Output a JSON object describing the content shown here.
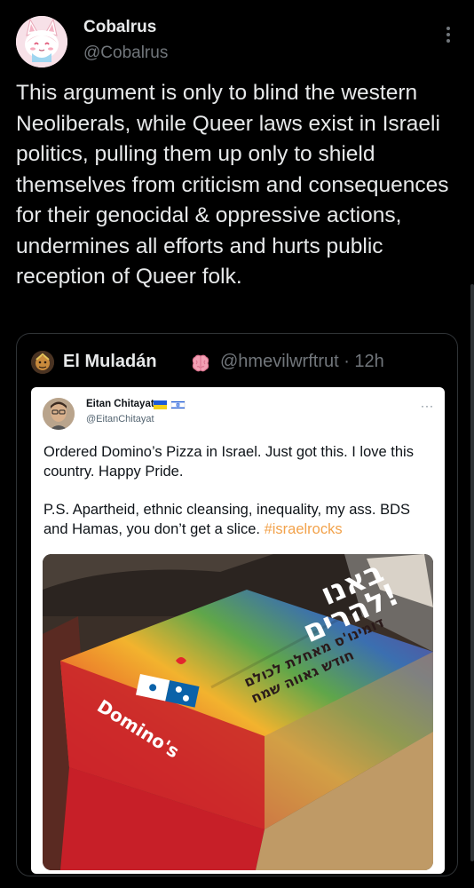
{
  "post": {
    "author_name": "Cobalrus",
    "author_handle": "@Cobalrus",
    "text": "This argument is only to blind the western Neoliberals, while Queer laws exist in Israeli politics, pulling them up only to shield themselves from criticism and consequences for their genocidal & oppressive actions, undermines all efforts and hurts public reception of Queer folk."
  },
  "quote": {
    "author_name": "El Muladán",
    "author_handle": "@hmevilwrftrut · 12h",
    "screenshot": {
      "author_name": "Eitan Chitayat",
      "author_handle": "@EitanChitayat",
      "more": "···",
      "text_1": "Ordered Domino’s Pizza in Israel. Just got this. I love this country. Happy Pride.",
      "text_2": "P.S. Apartheid, ethnic cleansing, inequality, my ass. BDS and Hamas, you don’t get a slice.",
      "hashtag": "#israelrocks",
      "box_brand": "Domino's",
      "box_headline_1": "באנו",
      "box_headline_2": "להרים!",
      "box_subtext_1": "דומינו'ס מאחלת לכולם",
      "box_subtext_2": "חודש גאווה שמח"
    }
  },
  "colors": {
    "background": "#000000",
    "text": "#e7e9ea",
    "muted": "#71767b",
    "hashtag": "#f2a24b"
  }
}
